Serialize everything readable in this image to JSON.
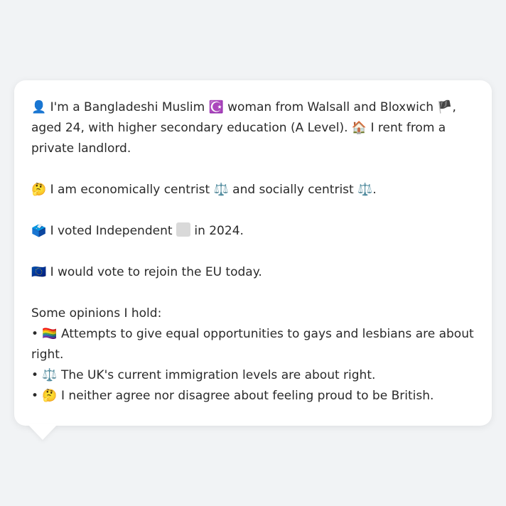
{
  "profile": {
    "intro_line": "👤 I'm a Bangladeshi Muslim ☪️ woman from Walsall and Bloxwich 🏴, aged 24, with higher secondary education (A Level). 🏠 I rent from a private landlord.",
    "ideology_line": "🤔 I am economically centrist ⚖️ and socially centrist ⚖️.",
    "vote_prefix": "🗳️ I voted Independent",
    "vote_suffix": "in 2024.",
    "eu_line": "🇪🇺 I would vote to rejoin the EU today.",
    "opinions_heading": "Some opinions I hold:",
    "opinions": [
      "• 🏳️‍🌈 Attempts to give equal opportunities to gays and lesbians are about right.",
      "• ⚖️ The UK's current immigration levels are about right.",
      "• 🤔 I neither agree nor disagree about feeling proud to be British."
    ]
  },
  "colors": {
    "background": "#f1f3f5",
    "card": "#ffffff",
    "text": "#2a2a2a",
    "independent_swatch": "#d9d9d9"
  }
}
